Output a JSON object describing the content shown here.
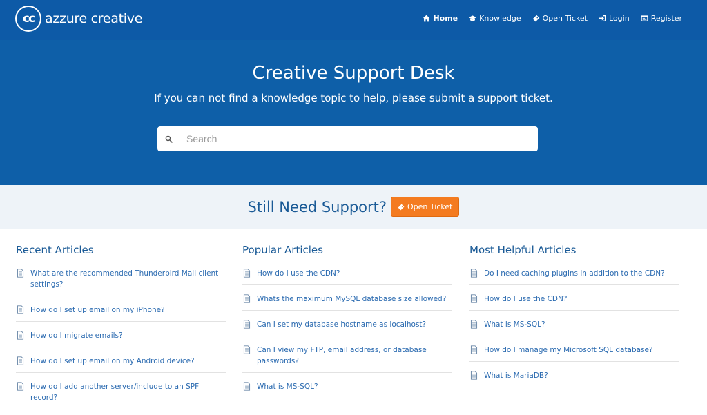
{
  "brand": {
    "logo_mark": "cc",
    "name": "azzure creative"
  },
  "nav": [
    {
      "label": "Home",
      "icon": "home-icon",
      "active": true
    },
    {
      "label": "Knowledge",
      "icon": "graduation-cap-icon",
      "active": false
    },
    {
      "label": "Open Ticket",
      "icon": "ticket-icon",
      "active": false
    },
    {
      "label": "Login",
      "icon": "sign-in-icon",
      "active": false
    },
    {
      "label": "Register",
      "icon": "register-icon",
      "active": false
    }
  ],
  "hero": {
    "title": "Creative Support Desk",
    "subtitle": "If you can not find a knowledge topic to help, please submit a support ticket.",
    "search_placeholder": "Search"
  },
  "support": {
    "title": "Still Need Support?",
    "button_label": "Open Ticket"
  },
  "columns": [
    {
      "title": "Recent Articles",
      "items": [
        "What are the recommended Thunderbird Mail client settings?",
        "How do I set up email on my iPhone?",
        "How do I migrate emails?",
        "How do I set up email on my Android device?",
        "How do I add another server/include to an SPF record?"
      ]
    },
    {
      "title": "Popular Articles",
      "items": [
        "How do I use the CDN?",
        "Whats the maximum MySQL database size allowed?",
        "Can I set my database hostname as localhost?",
        "Can I view my FTP, email address, or database passwords?",
        "What is MS-SQL?"
      ]
    },
    {
      "title": "Most Helpful Articles",
      "items": [
        "Do I need caching plugins in addition to the CDN?",
        "How do I use the CDN?",
        "What is MS-SQL?",
        "How do I manage my Microsoft SQL database?",
        "What is MariaDB?"
      ]
    }
  ],
  "colors": {
    "header_bg": "#0d5aa7",
    "hero_bg": "#0e5fa8",
    "strip_bg": "#eef3f8",
    "heading": "#1a5a96",
    "link": "#2a6ab0",
    "accent_button": "#f47b20"
  }
}
